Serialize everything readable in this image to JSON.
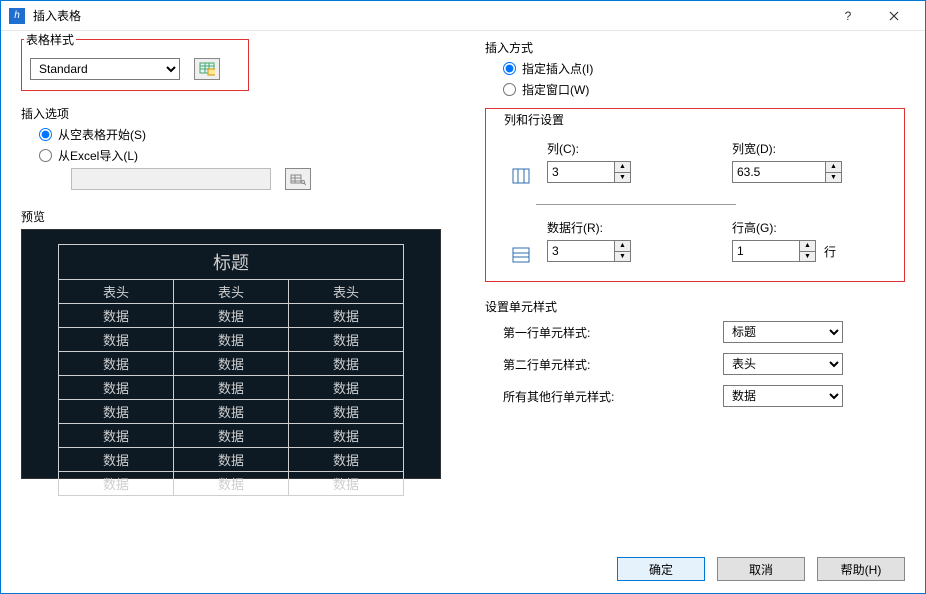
{
  "titlebar": {
    "title": "插入表格"
  },
  "style": {
    "label": "表格样式",
    "value": "Standard"
  },
  "insertOptions": {
    "label": "插入选项",
    "fromBlank": "从空表格开始(S)",
    "fromExcel": "从Excel导入(L)"
  },
  "preview": {
    "label": "预览",
    "title": "标题",
    "header": "表头",
    "data": "数据"
  },
  "insertMode": {
    "label": "插入方式",
    "point": "指定插入点(I)",
    "window": "指定窗口(W)"
  },
  "colrow": {
    "label": "列和行设置",
    "colsLabel": "列(C):",
    "cols": "3",
    "colWidthLabel": "列宽(D):",
    "colWidth": "63.5",
    "dataRowsLabel": "数据行(R):",
    "dataRows": "3",
    "rowHeightLabel": "行高(G):",
    "rowHeight": "1",
    "rowUnit": "行"
  },
  "cellStyles": {
    "label": "设置单元样式",
    "row1Label": "第一行单元样式:",
    "row1": "标题",
    "row2Label": "第二行单元样式:",
    "row2": "表头",
    "otherLabel": "所有其他行单元样式:",
    "other": "数据"
  },
  "buttons": {
    "ok": "确定",
    "cancel": "取消",
    "help": "帮助(H)"
  }
}
